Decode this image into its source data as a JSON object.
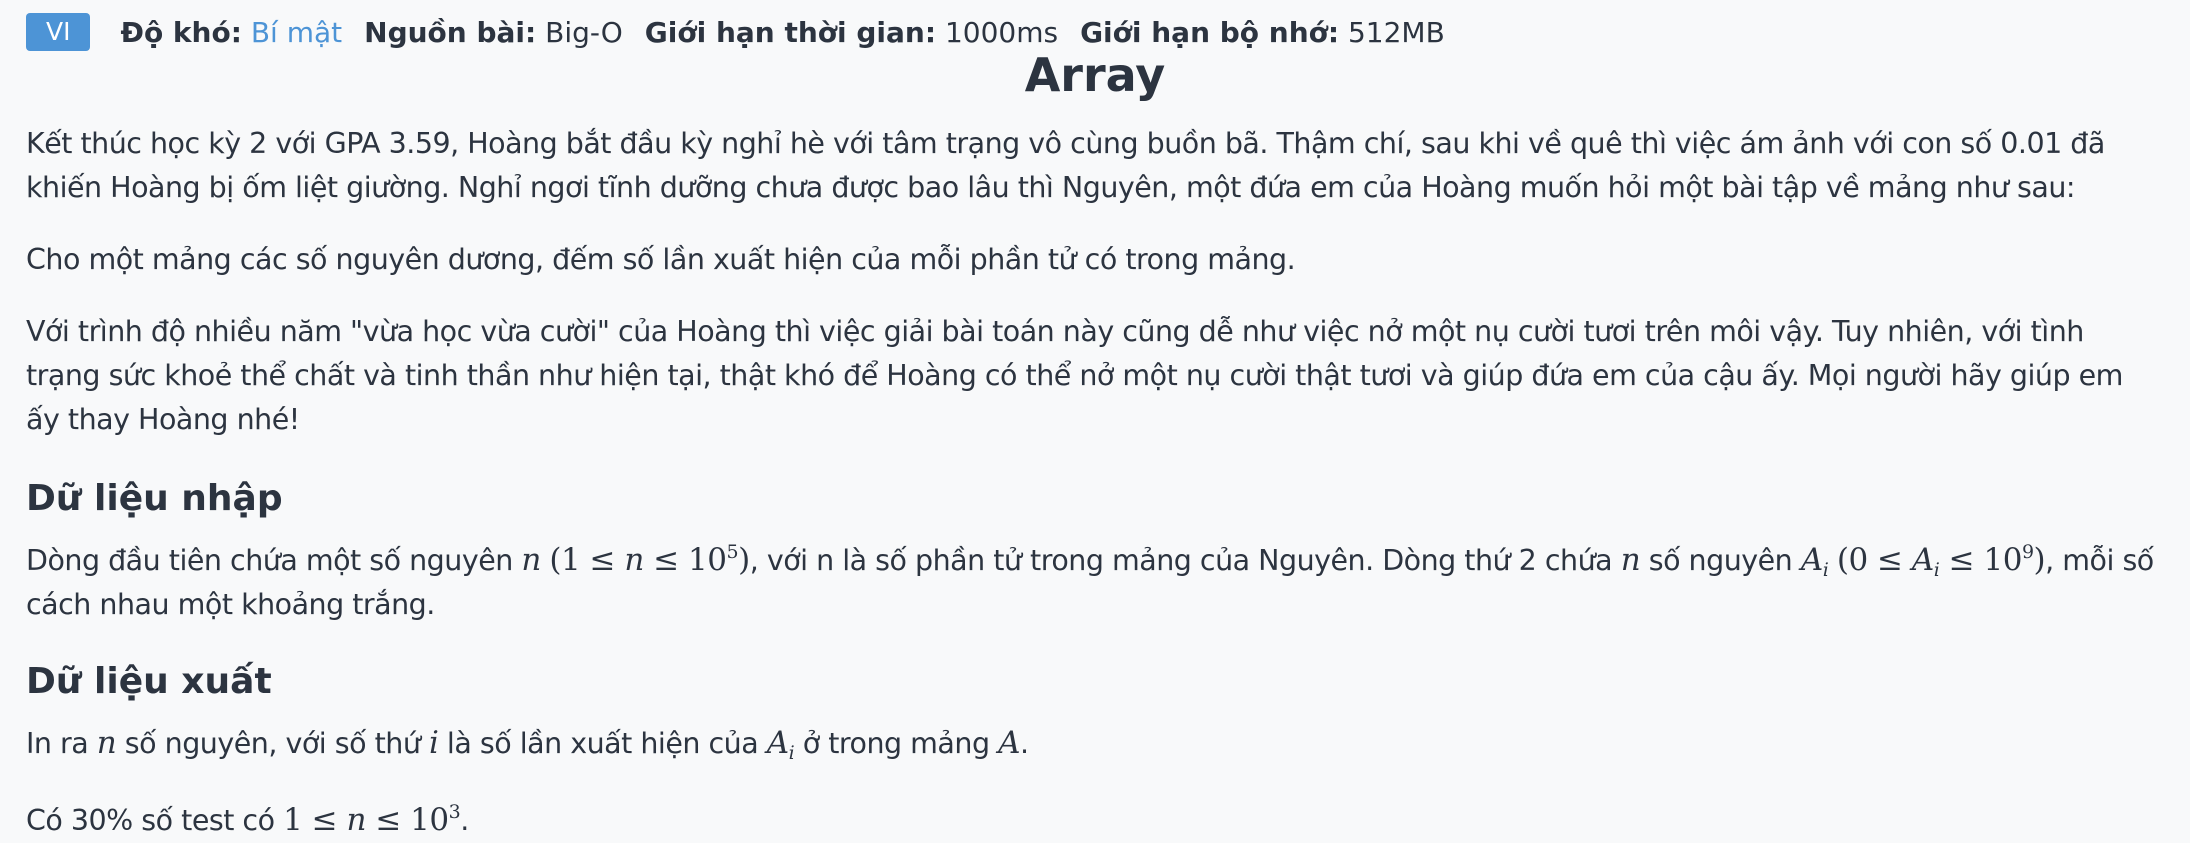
{
  "meta": {
    "language_badge": "VI",
    "difficulty_label": "Độ khó:",
    "difficulty_value": "Bí mật",
    "source_label": "Nguồn bài:",
    "source_value": "Big-O",
    "time_limit_label": "Giới hạn thời gian:",
    "time_limit_value": "1000ms",
    "memory_limit_label": "Giới hạn bộ nhớ:",
    "memory_limit_value": "512MB"
  },
  "problem": {
    "title": "Array",
    "paragraph_1": "Kết thúc học kỳ 2 với GPA 3.59, Hoàng bắt đầu kỳ nghỉ hè với tâm trạng vô cùng buồn bã. Thậm chí, sau khi về quê thì việc ám ảnh với con số 0.01 đã khiến Hoàng bị ốm liệt giường. Nghỉ ngơi tĩnh dưỡng chưa được bao lâu thì Nguyên, một đứa em của Hoàng muốn hỏi một bài tập về mảng như sau:",
    "paragraph_2": "Cho một mảng các số nguyên dương, đếm số lần xuất hiện của mỗi phần tử có trong mảng.",
    "paragraph_3": "Với trình độ nhiều năm \"vừa học vừa cười\" của Hoàng thì việc giải bài toán này cũng dễ như việc nở một nụ cười tươi trên môi vậy. Tuy nhiên, với tình trạng sức khoẻ thể chất và tinh thần như hiện tại, thật khó để Hoàng có thể nở một nụ cười thật tươi và giúp đứa em của cậu ấy. Mọi người hãy giúp em ấy thay Hoàng nhé!",
    "input_heading": "Dữ liệu nhập",
    "input_text_1": "Dòng đầu tiên chứa một số nguyên ",
    "input_math_1_var": "n",
    "input_math_1_cond_a": "(1 ≤ ",
    "input_math_1_cond_var": "n",
    "input_math_1_cond_b": " ≤ 10",
    "input_math_1_exp": "5",
    "input_math_1_cond_c": ")",
    "input_text_2": ", với n là số phần tử trong mảng của Nguyên. Dòng thứ 2 chứa ",
    "input_math_2_var": "n",
    "input_text_3": " số nguyên ",
    "input_math_3_var": "A",
    "input_math_3_sub": "i",
    "input_math_4_a": "(0 ≤ ",
    "input_math_4_var": "A",
    "input_math_4_sub": "i",
    "input_math_4_b": " ≤ 10",
    "input_math_4_exp": "9",
    "input_math_4_c": ")",
    "input_text_4": ", mỗi số cách nhau một khoảng trắng.",
    "output_heading": "Dữ liệu xuất",
    "output_text_1": "In ra ",
    "output_math_n": "n",
    "output_text_2": " số nguyên, với số thứ ",
    "output_math_i": "i",
    "output_text_3": " là số lần xuất hiện của ",
    "output_math_a": "A",
    "output_math_a_sub": "i",
    "output_text_4": " ở trong mảng ",
    "output_math_arr": "A",
    "output_text_5": ".",
    "constraint_text_1": "Có 30% số test có ",
    "constraint_math_a": "1 ≤ ",
    "constraint_math_var": "n",
    "constraint_math_b": " ≤ 10",
    "constraint_math_exp": "3",
    "constraint_text_2": "."
  },
  "colors": {
    "accent": "#4d94d6",
    "text": "#2c3440",
    "background": "#f8f9fa"
  }
}
